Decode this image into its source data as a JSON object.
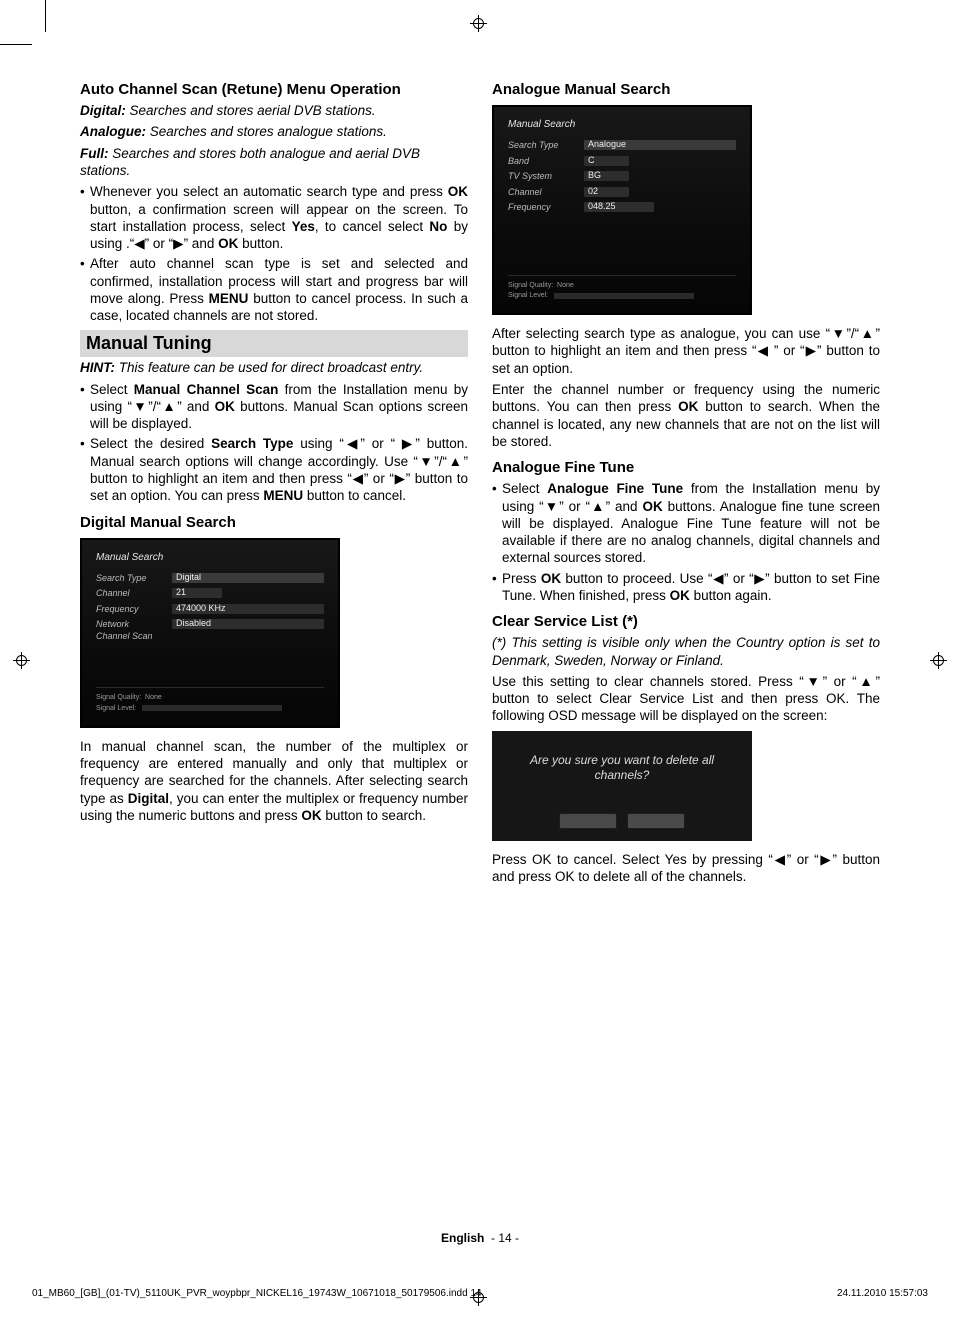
{
  "col1": {
    "h1": "Auto Channel Scan (Retune) Menu Operation",
    "p1a": "Digital:",
    "p1b": " Searches and stores aerial DVB stations.",
    "p2a": "Analogue:",
    "p2b": " Searches and stores analogue stations.",
    "p3a": "Full:",
    "p3b": " Searches and stores both analogue and aerial DVB stations.",
    "b1_pre": "Whenever you select an automatic search type and press ",
    "b1_ok": "OK",
    "b1_m1": " button, a confirmation screen will appear on the screen. To start installation process, select ",
    "b1_yes": "Yes",
    "b1_m2": ", to cancel select ",
    "b1_no": "No",
    "b1_m3": " by using .“",
    "b1_left": "◀",
    "b1_m4": "” or “",
    "b1_right": "▶",
    "b1_m5": "” and ",
    "b1_ok2": "OK",
    "b1_m6": " button.",
    "b2_pre": "After auto channel scan type is set and selected and confirmed, installation process will start and progress bar will move along. Press ",
    "b2_menu": "MENU",
    "b2_post": " button to cancel process. In such a case, located channels are not stored.",
    "bar1": "Manual Tuning",
    "hint_a": "HINT:",
    "hint_b": " This feature can be used for direct broadcast entry.",
    "m1_pre": "Select ",
    "m1_mcs": "Manual Channel Scan",
    "m1_m1": " from the Installation menu by using “",
    "m1_dn": "▼",
    "m1_m2": "”/“",
    "m1_up": "▲",
    "m1_m3": "” and ",
    "m1_ok": "OK",
    "m1_m4": " buttons. Manual Scan options screen will be displayed.",
    "m2_pre": "Select the desired ",
    "m2_st": "Search Type",
    "m2_m1": " using “",
    "m2_l": "◀",
    "m2_m2": "” or “ ",
    "m2_r": "▶",
    "m2_m3": "” button. Manual search options will change accordingly. Use “",
    "m2_dn": "▼",
    "m2_m4": "”/“",
    "m2_up": "▲",
    "m2_m5": "” button to highlight an item and then press “",
    "m2_l2": "◀",
    "m2_m6": "” or “",
    "m2_r2": "▶",
    "m2_m7": "” button to set an option. You can press ",
    "m2_menu": "MENU",
    "m2_m8": " button to cancel.",
    "h2": "Digital Manual Search",
    "dms_pre": "In manual channel scan, the number of the multiplex or frequency are entered manually and only that multiplex or frequency are searched for the channels. After selecting search type as ",
    "dms_dig": "Digital",
    "dms_m1": ", you can enter the multiplex or frequency number using the numeric buttons and press ",
    "dms_ok": "OK",
    "dms_m2": " button to search."
  },
  "col2": {
    "h1": "Analogue Manual Search",
    "a1_pre": "After selecting search type as analogue, you can use “",
    "a1_dn": "▼",
    "a1_m1": "”/“",
    "a1_up": "▲",
    "a1_m2": "” button to highlight an item and then press “",
    "a1_l": "◀",
    "a1_m3": " ” or “",
    "a1_r": "▶",
    "a1_m4": "” button to set an option.",
    "a2_pre": "Enter the channel number or frequency using the numeric buttons. You can then press ",
    "a2_ok": "OK",
    "a2_post": " button to search. When the channel is located, any new channels that are not on the list will be stored.",
    "h2": "Analogue Fine Tune",
    "ft1_pre": "Select ",
    "ft1_aft": "Analogue Fine Tune",
    "ft1_m1": " from the Installation menu by using “",
    "ft1_dn": "▼",
    "ft1_m2": "” or “",
    "ft1_up": "▲",
    "ft1_m3": "” and ",
    "ft1_ok": "OK",
    "ft1_m4": " buttons. Analogue fine tune screen will be displayed. Analogue Fine Tune feature will not be available if there are no analog channels, digital channels and external sources stored.",
    "ft2_pre": "Press ",
    "ft2_ok": "OK",
    "ft2_m1": " button to proceed. Use “",
    "ft2_l": "◀",
    "ft2_m2": "” or “",
    "ft2_r": "▶",
    "ft2_m3": "” button to set Fine Tune. When finished, press ",
    "ft2_ok2": "OK",
    "ft2_m4": " button again.",
    "h3": "Clear Service List (*)",
    "csl_note": "(*) This setting is visible only when the Country option is set to Denmark, Sweden, Norway or Finland.",
    "csl_pre": "Use this setting to clear channels stored. Press “",
    "csl_dn": "▼",
    "csl_m1": "” or “",
    "csl_up": "▲",
    "csl_m2": "” button to select Clear Service List and then press OK. The following OSD message will be displayed on the screen:",
    "confirm_msg": "Are you sure you want to delete all channels?",
    "csl2_pre": "Press OK to cancel. Select Yes by pressing “",
    "csl2_l": "◀",
    "csl2_m1": "” or “",
    "csl2_r": "▶",
    "csl2_m2": "” button and press OK to delete all of the channels."
  },
  "footer": {
    "lang": "English",
    "page": "- 14 -",
    "file": "01_MB60_[GB]_(01-TV)_5110UK_PVR_woypbpr_NICKEL16_19743W_10671018_50179506.indd   14",
    "ts": "24.11.2010   15:57:03"
  },
  "osd": {
    "digital": {
      "title": "Manual Search",
      "r1l": "Search Type",
      "r1v": "Digital",
      "r2l": "Channel",
      "r2v": "21",
      "r3l": "Frequency",
      "r3v": "474000 KHz",
      "r4l": "Network Channel Scan",
      "r4v": "Disabled",
      "fl1": "Signal Quality:",
      "fv1": "None",
      "fl2": "Signal Level:"
    },
    "analogue": {
      "title": "Manual Search",
      "r1l": "Search Type",
      "r1v": "Analogue",
      "r2l": "Band",
      "r2v": "C",
      "r3l": "TV System",
      "r3v": "BG",
      "r4l": "Channel",
      "r4v": "02",
      "r5l": "Frequency",
      "r5v": "048.25",
      "fl1": "Signal Quality:",
      "fv1": "None",
      "fl2": "Signal Level:"
    }
  }
}
